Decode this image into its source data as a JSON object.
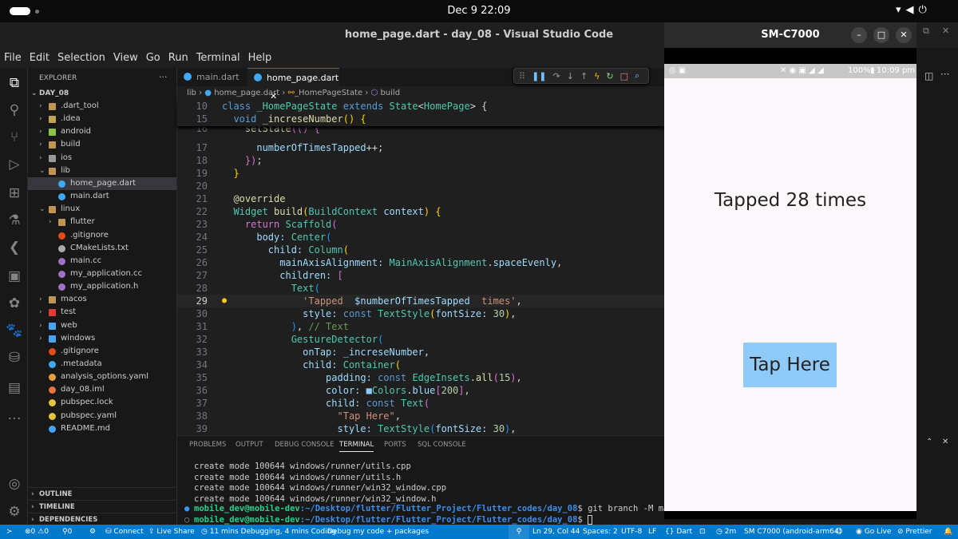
{
  "system": {
    "datetime": "Dec 9  22:09"
  },
  "window": {
    "title": "home_page.dart - day_08 - Visual Studio Code"
  },
  "menu": [
    "File",
    "Edit",
    "Selection",
    "View",
    "Go",
    "Run",
    "Terminal",
    "Help"
  ],
  "explorer": {
    "title": "EXPLORER",
    "more": "···",
    "root": "DAY_08",
    "items": [
      {
        "label": ".dart_tool",
        "depth": 0,
        "folder": true,
        "color": "#c09553"
      },
      {
        "label": ".idea",
        "depth": 0,
        "folder": true,
        "color": "#c0a553"
      },
      {
        "label": "android",
        "depth": 0,
        "folder": true,
        "color": "#8bc34a"
      },
      {
        "label": "build",
        "depth": 0,
        "folder": true,
        "color": "#c09553"
      },
      {
        "label": "ios",
        "depth": 0,
        "folder": true,
        "color": "#999999"
      },
      {
        "label": "lib",
        "depth": 0,
        "folder": true,
        "open": true,
        "color": "#c09553"
      },
      {
        "label": "home_page.dart",
        "depth": 1,
        "folder": false,
        "color": "#3fa9f5",
        "selected": true
      },
      {
        "label": "main.dart",
        "depth": 1,
        "folder": false,
        "color": "#3fa9f5"
      },
      {
        "label": "linux",
        "depth": 0,
        "folder": true,
        "open": true,
        "color": "#c09553"
      },
      {
        "label": "flutter",
        "depth": 1,
        "folder": true,
        "color": "#c09553"
      },
      {
        "label": ".gitignore",
        "depth": 1,
        "folder": false,
        "color": "#e64a19"
      },
      {
        "label": "CMakeLists.txt",
        "depth": 1,
        "folder": false,
        "color": "#aaaaaa"
      },
      {
        "label": "main.cc",
        "depth": 1,
        "folder": false,
        "color": "#a074c4"
      },
      {
        "label": "my_application.cc",
        "depth": 1,
        "folder": false,
        "color": "#a074c4"
      },
      {
        "label": "my_application.h",
        "depth": 1,
        "folder": false,
        "color": "#a074c4"
      },
      {
        "label": "macos",
        "depth": 0,
        "folder": true,
        "color": "#c09553"
      },
      {
        "label": "test",
        "depth": 0,
        "folder": true,
        "color": "#e53935"
      },
      {
        "label": "web",
        "depth": 0,
        "folder": true,
        "color": "#42a5f5"
      },
      {
        "label": "windows",
        "depth": 0,
        "folder": true,
        "color": "#42a5f5"
      },
      {
        "label": ".gitignore",
        "depth": 0,
        "folder": false,
        "color": "#e64a19"
      },
      {
        "label": ".metadata",
        "depth": 0,
        "folder": false,
        "color": "#3fa9f5"
      },
      {
        "label": "analysis_options.yaml",
        "depth": 0,
        "folder": false,
        "color": "#e8a13a"
      },
      {
        "label": "day_08.iml",
        "depth": 0,
        "folder": false,
        "color": "#e8743a"
      },
      {
        "label": "pubspec.lock",
        "depth": 0,
        "folder": false,
        "color": "#e8c13a"
      },
      {
        "label": "pubspec.yaml",
        "depth": 0,
        "folder": false,
        "color": "#e8c13a"
      },
      {
        "label": "README.md",
        "depth": 0,
        "folder": false,
        "color": "#42a5f5"
      }
    ],
    "sections": [
      "OUTLINE",
      "TIMELINE",
      "DEPENDENCIES"
    ]
  },
  "tabs": [
    {
      "label": "main.dart"
    },
    {
      "label": "home_page.dart",
      "active": true,
      "close": "✕"
    }
  ],
  "breadcrumb": [
    "lib",
    "home_page.dart",
    "_HomePageState",
    "build"
  ],
  "sticky": [
    {
      "n": "10",
      "t": [
        [
          "class ",
          "kw"
        ],
        [
          "_HomePageState ",
          "cls"
        ],
        [
          "extends ",
          "kw"
        ],
        [
          "State",
          "cls"
        ],
        [
          "<",
          "pl"
        ],
        [
          "HomePage",
          "cls"
        ],
        [
          "> {",
          "pl"
        ]
      ]
    },
    {
      "n": "15",
      "t": [
        [
          "  void ",
          "kw"
        ],
        [
          "_increseNumber",
          "fn"
        ],
        [
          "() {",
          "br1"
        ]
      ]
    }
  ],
  "code": [
    {
      "n": "16",
      "t": [
        [
          "    setState",
          "fn"
        ],
        [
          "(() {",
          "br2"
        ]
      ]
    },
    {
      "n": "17",
      "t": [
        [
          "      numberOfTimesTapped",
          "var"
        ],
        [
          "++;",
          "pl"
        ]
      ]
    },
    {
      "n": "18",
      "t": [
        [
          "    })",
          "br2"
        ],
        [
          ";",
          "pl"
        ]
      ]
    },
    {
      "n": "19",
      "t": [
        [
          "  }",
          "br1"
        ]
      ]
    },
    {
      "n": "20",
      "t": []
    },
    {
      "n": "21",
      "t": [
        [
          "  @override",
          "dec"
        ]
      ]
    },
    {
      "n": "22",
      "t": [
        [
          "  Widget ",
          "cls"
        ],
        [
          "build",
          "fn"
        ],
        [
          "(",
          "br1"
        ],
        [
          "BuildContext ",
          "cls"
        ],
        [
          "context",
          "var"
        ],
        [
          ") {",
          "br1"
        ]
      ]
    },
    {
      "n": "23",
      "t": [
        [
          "    return ",
          "br2"
        ],
        [
          "Scaffold",
          "cls"
        ],
        [
          "(",
          "br2"
        ]
      ]
    },
    {
      "n": "24",
      "t": [
        [
          "      body: ",
          "var"
        ],
        [
          "Center",
          "cls"
        ],
        [
          "(",
          "br3"
        ]
      ]
    },
    {
      "n": "25",
      "t": [
        [
          "        child: ",
          "var"
        ],
        [
          "Column",
          "cls"
        ],
        [
          "(",
          "br1"
        ]
      ]
    },
    {
      "n": "26",
      "t": [
        [
          "          mainAxisAlignment: ",
          "var"
        ],
        [
          "MainAxisAlignment",
          "cls"
        ],
        [
          ".",
          "pl"
        ],
        [
          "spaceEvenly",
          "var"
        ],
        [
          ",",
          "pl"
        ]
      ]
    },
    {
      "n": "27",
      "t": [
        [
          "          children: ",
          "var"
        ],
        [
          "[",
          "br2"
        ]
      ]
    },
    {
      "n": "28",
      "t": [
        [
          "            Text",
          "cls"
        ],
        [
          "(",
          "br3"
        ]
      ]
    },
    {
      "n": "29",
      "t": [
        [
          "              'Tapped  ",
          "str"
        ],
        [
          "$numberOfTimesTapped",
          "var"
        ],
        [
          "  times'",
          "str"
        ],
        [
          ",",
          "pl"
        ]
      ],
      "bulb": true
    },
    {
      "n": "30",
      "t": [
        [
          "              style: ",
          "var"
        ],
        [
          "const ",
          "kw"
        ],
        [
          "TextStyle",
          "cls"
        ],
        [
          "(",
          "br1"
        ],
        [
          "fontSize: ",
          "var"
        ],
        [
          "30",
          "num"
        ],
        [
          ")",
          "br1"
        ],
        [
          ",",
          "pl"
        ]
      ]
    },
    {
      "n": "31",
      "t": [
        [
          "            )",
          "br3"
        ],
        [
          ", ",
          "pl"
        ],
        [
          "// Text",
          "cmt"
        ]
      ]
    },
    {
      "n": "32",
      "t": [
        [
          "            GestureDetector",
          "cls"
        ],
        [
          "(",
          "br3"
        ]
      ]
    },
    {
      "n": "33",
      "t": [
        [
          "              onTap: ",
          "var"
        ],
        [
          "_increseNumber",
          "var"
        ],
        [
          ",",
          "pl"
        ]
      ]
    },
    {
      "n": "34",
      "t": [
        [
          "              child: ",
          "var"
        ],
        [
          "Container",
          "cls"
        ],
        [
          "(",
          "br1"
        ]
      ]
    },
    {
      "n": "35",
      "t": [
        [
          "                  padding: ",
          "var"
        ],
        [
          "const ",
          "kw"
        ],
        [
          "EdgeInsets",
          "cls"
        ],
        [
          ".",
          "pl"
        ],
        [
          "all",
          "fn"
        ],
        [
          "(",
          "br2"
        ],
        [
          "15",
          "num"
        ],
        [
          ")",
          "br2"
        ],
        [
          ",",
          "pl"
        ]
      ]
    },
    {
      "n": "36",
      "t": [
        [
          "                  color: ",
          "var"
        ],
        [
          "■",
          "var"
        ],
        [
          "Colors",
          "cls"
        ],
        [
          ".",
          "pl"
        ],
        [
          "blue",
          "var"
        ],
        [
          "[",
          "br2"
        ],
        [
          "200",
          "num"
        ],
        [
          "]",
          "br2"
        ],
        [
          ",",
          "pl"
        ]
      ]
    },
    {
      "n": "37",
      "t": [
        [
          "                  child: ",
          "var"
        ],
        [
          "const ",
          "kw"
        ],
        [
          "Text",
          "cls"
        ],
        [
          "(",
          "br2"
        ]
      ]
    },
    {
      "n": "38",
      "t": [
        [
          "                    \"Tap Here\"",
          "str"
        ],
        [
          ",",
          "pl"
        ]
      ]
    },
    {
      "n": "39",
      "t": [
        [
          "                    style: ",
          "var"
        ],
        [
          "TextStyle",
          "cls"
        ],
        [
          "(",
          "br3"
        ],
        [
          "fontSize: ",
          "var"
        ],
        [
          "30",
          "num"
        ],
        [
          ")",
          "br3"
        ],
        [
          ",",
          "pl"
        ]
      ]
    }
  ],
  "panel": {
    "tabs": [
      "PROBLEMS",
      "OUTPUT",
      "DEBUG CONSOLE",
      "TERMINAL",
      "PORTS",
      "SQL CONSOLE"
    ],
    "active": "TERMINAL",
    "lines": [
      "create mode 100644 windows/runner/utils.cpp",
      "create mode 100644 windows/runner/utils.h",
      "create mode 100644 windows/runner/win32_window.cpp",
      "create mode 100644 windows/runner/win32_window.h"
    ],
    "prompt_user": "mobile_dev@mobile-dev",
    "prompt_path": ":~/Desktop/flutter/Flutter_Project/Flutter_codes/day_08",
    "cmd1": "$ git branch -M main",
    "cmd2": "$ "
  },
  "status": {
    "errors": "⊗0",
    "warnings": "⚠0",
    "ports": "⚲0",
    "connect": "Connect",
    "liveshare": "Live Share",
    "time": "11 mins Debugging, 4 mins Coding",
    "debug": "Debug my code + packages",
    "position": "Ln 29, Col 44",
    "spaces": "Spaces: 2",
    "encoding": "UTF-8",
    "eol": "LF",
    "language": "{} Dart",
    "timer": "2m",
    "device": "SM C7000 (android-arm64)",
    "golive": "Go Live",
    "prettier": "Prettier"
  },
  "emulator": {
    "title": "SM-C7000",
    "phone_status": {
      "battery": "100%",
      "time": "10:09 pm"
    },
    "tapped_text": "Tapped  28  times",
    "button": "Tap Here",
    "button_color": "#90caf9"
  }
}
